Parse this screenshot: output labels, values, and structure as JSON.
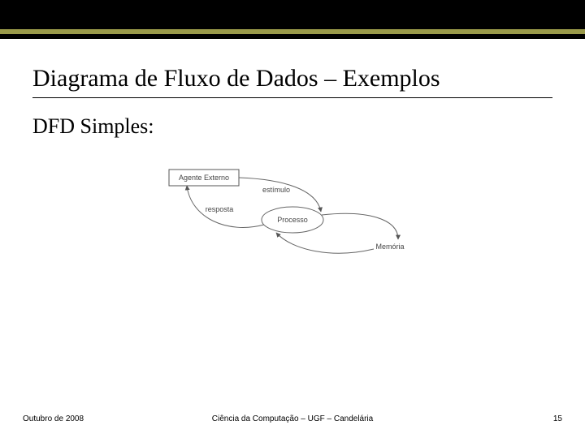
{
  "header": {
    "title": "Diagrama de Fluxo de Dados – Exemplos"
  },
  "body": {
    "subtitle": "DFD Simples:"
  },
  "diagram": {
    "agent_label": "Agente Externo",
    "process_label": "Processo",
    "memory_label": "Memória",
    "stimulus_label": "estímulo",
    "response_label": "resposta"
  },
  "footer": {
    "left": "Outubro de 2008",
    "center": "Ciência da Computação – UGF – Candelária",
    "right": "15"
  }
}
